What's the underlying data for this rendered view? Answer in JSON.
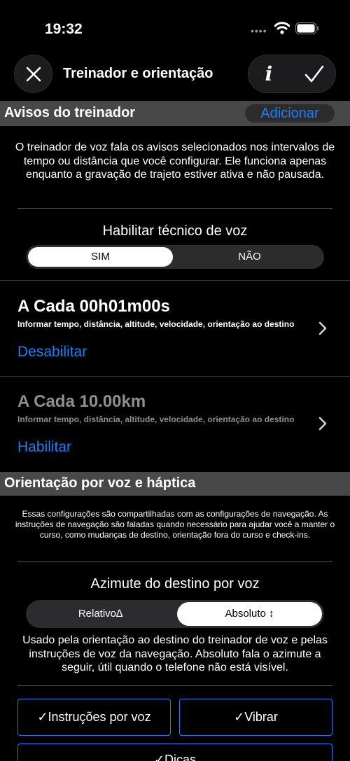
{
  "status_bar": {
    "time": "19:32",
    "signal": "••••"
  },
  "nav": {
    "title": "Treinador e orientação",
    "info_label": "i"
  },
  "coach_section": {
    "title": "Avisos do treinador",
    "add_label": "Adicionar",
    "description": "O treinador de voz fala os avisos selecionados nos intervalos de tempo ou distância que você configurar. Ele funciona apenas enquanto a gravação de trajeto estiver ativa e não pausada.",
    "enable_label": "Habilitar técnico de voz",
    "enable_options": [
      "SIM",
      "NÃO"
    ],
    "enable_selected": "SIM"
  },
  "triggers": [
    {
      "title": "A Cada 00h01m00s",
      "desc": "Informar tempo, distância, altitude, velocidade, orientação ao destino",
      "action": "Desabilitar",
      "enabled": true
    },
    {
      "title": "A Cada 10.00km",
      "desc": "Informar tempo, distância, altitude, velocidade, orientação ao destino",
      "action": "Habilitar",
      "enabled": false
    }
  ],
  "guidance_section": {
    "title": "Orientação por voz e háptica",
    "description": "Essas configurações são compartilhadas com as configurações de navegação. As instruções de navegação são faladas quando necessário para ajudar você a manter o curso, como mudanças de destino, orientação fora do curso e check-ins.",
    "bearing_label": "Azimute do destino por voz",
    "bearing_options": [
      "Relativo∆",
      "Absoluto ↕"
    ],
    "bearing_selected": "Absoluto ↕",
    "bearing_description": "Usado pela orientação ao destino do treinador de voz e pelas instruções de voz da navegação. Absoluto fala o azimute a seguir, útil quando o telefone não está visível.",
    "toggles": [
      "✓Instruções por voz",
      "✓Vibrar",
      "✓Dicas"
    ]
  }
}
